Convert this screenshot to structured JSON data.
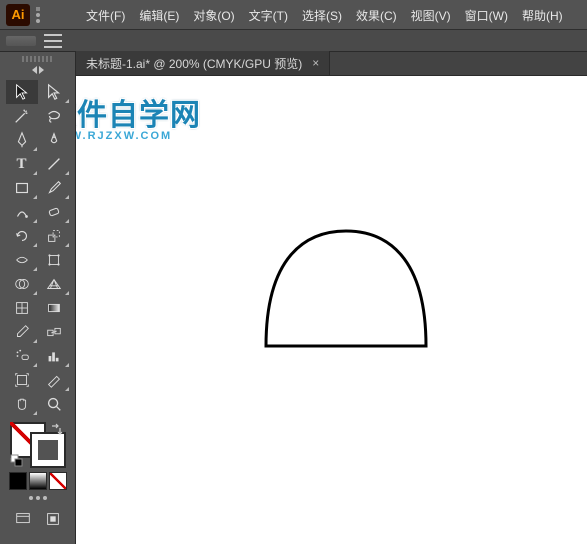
{
  "app": {
    "logo_text": "Ai"
  },
  "menu": {
    "file": "文件(F)",
    "edit": "编辑(E)",
    "object": "对象(O)",
    "type": "文字(T)",
    "select": "选择(S)",
    "effect": "效果(C)",
    "view": "视图(V)",
    "window": "窗口(W)",
    "help": "帮助(H)"
  },
  "tab": {
    "title": "未标题-1.ai* @ 200% (CMYK/GPU 预览)",
    "close": "×"
  },
  "watermark": {
    "line1": "软件自学网",
    "line2": "WWW.RJZXW.COM"
  },
  "tools": {
    "selection": "selection",
    "direct_selection": "direct-selection",
    "magic_wand": "magic-wand",
    "lasso": "lasso",
    "pen": "pen",
    "curvature": "curvature",
    "type": "type",
    "line": "line",
    "rectangle": "rectangle",
    "paintbrush": "paintbrush",
    "shaper": "shaper",
    "eraser": "eraser",
    "rotate": "rotate",
    "scale": "scale",
    "width": "width",
    "free_transform": "free-transform",
    "shape_builder": "shape-builder",
    "perspective": "perspective",
    "mesh": "mesh",
    "gradient": "gradient",
    "eyedropper": "eyedropper",
    "blend": "blend",
    "symbol_sprayer": "symbol-sprayer",
    "column_graph": "column-graph",
    "artboard": "artboard",
    "slice": "slice",
    "hand": "hand",
    "zoom": "zoom"
  }
}
